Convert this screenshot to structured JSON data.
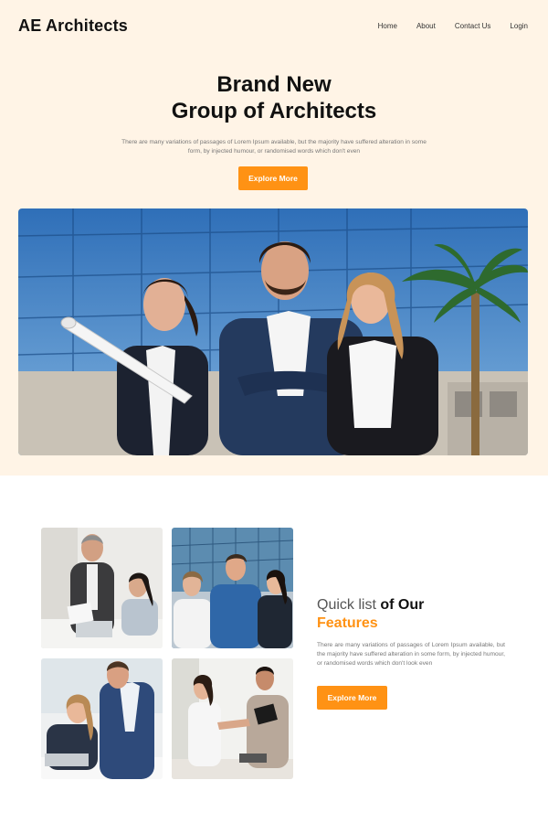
{
  "header": {
    "brand": "AE Architects",
    "nav": [
      "Home",
      "About",
      "Contact Us",
      "Login"
    ]
  },
  "hero": {
    "title_line1": "Brand New",
    "title_line2": "Group of Architects",
    "subtitle": "There are many variations of passages of Lorem Ipsum available, but the majority have suffered alteration in some form, by injected humour, or randomised words which don't even",
    "cta": "Explore More"
  },
  "features": {
    "title_light": "Quick list",
    "title_bold": "of Our",
    "title_accent": "Features",
    "text": "There are many variations of passages of Lorem Ipsum available, but the majority have suffered alteration in some form, by injected humour, or randomised words which don't look even",
    "cta": "Explore More"
  },
  "colors": {
    "accent": "#ff9214",
    "hero_bg": "#fff4e6"
  }
}
